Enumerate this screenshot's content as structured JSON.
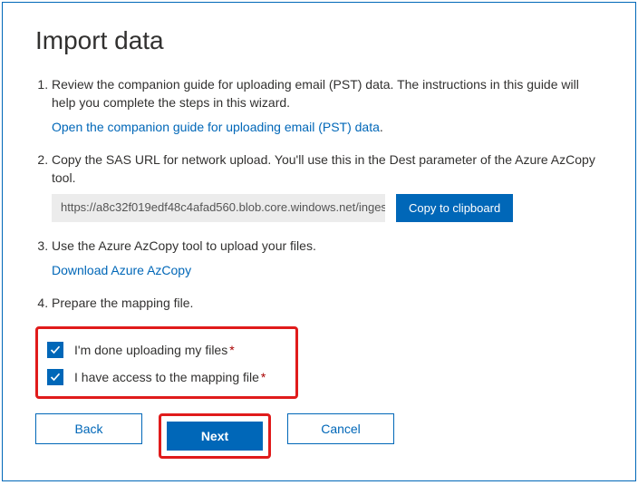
{
  "title": "Import data",
  "steps": {
    "s1_text": "Review the companion guide for uploading email (PST) data. The instructions in this guide will help you complete the steps in this wizard.",
    "s1_link": "Open the companion guide for uploading email (PST) data",
    "s2_text": "Copy the SAS URL for network upload. You'll use this in the Dest parameter of the Azure AzCopy tool.",
    "sas_url": "https://a8c32f019edf48c4afad560.blob.core.windows.net/inges",
    "copy_btn": "Copy to clipboard",
    "s3_text": "Use the Azure AzCopy tool to upload your files.",
    "s3_link": "Download Azure AzCopy",
    "s4_text": "Prepare the mapping file."
  },
  "checks": {
    "c1_label": "I'm done uploading my files",
    "c2_label": "I have access to the mapping file",
    "required_mark": "*"
  },
  "buttons": {
    "back": "Back",
    "next": "Next",
    "cancel": "Cancel"
  }
}
